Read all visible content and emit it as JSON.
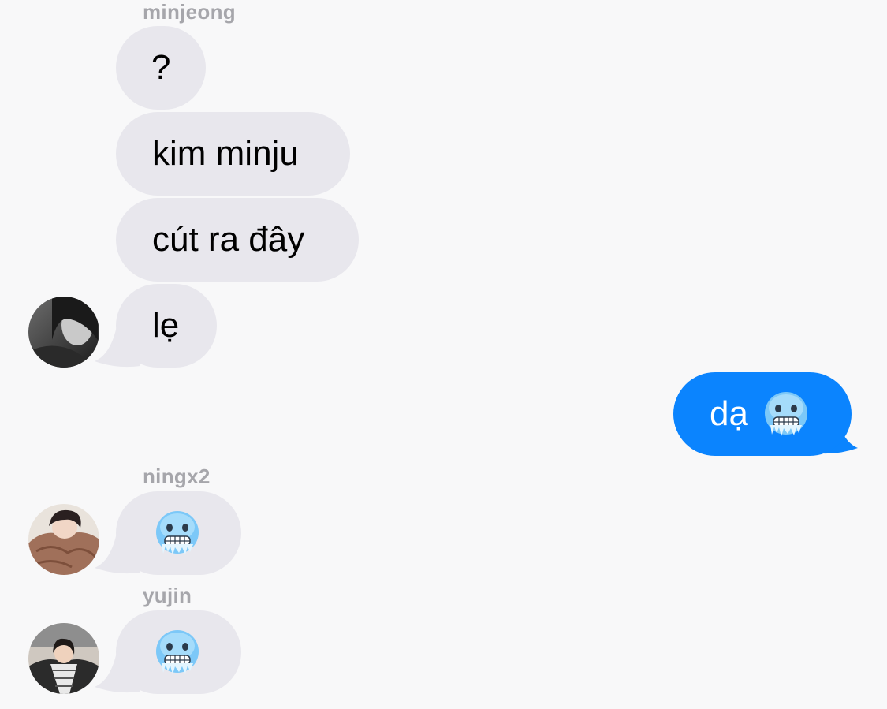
{
  "messages": [
    {
      "sender": "minjeong",
      "text": "?"
    },
    {
      "text": "kim minju"
    },
    {
      "text": "cút ra đây"
    },
    {
      "text": "lẹ"
    },
    {
      "outgoing": true,
      "text": "dạ",
      "emoji": "cold-face-emoji"
    },
    {
      "sender": "ningx2",
      "emoji": "cold-face-emoji"
    },
    {
      "sender": "yujin",
      "emoji": "cold-face-emoji"
    }
  ],
  "colors": {
    "background": "#f8f8f9",
    "incoming_bubble": "#e8e7ed",
    "outgoing_bubble": "#0b84fe",
    "sender_name": "#a6a6ab"
  }
}
